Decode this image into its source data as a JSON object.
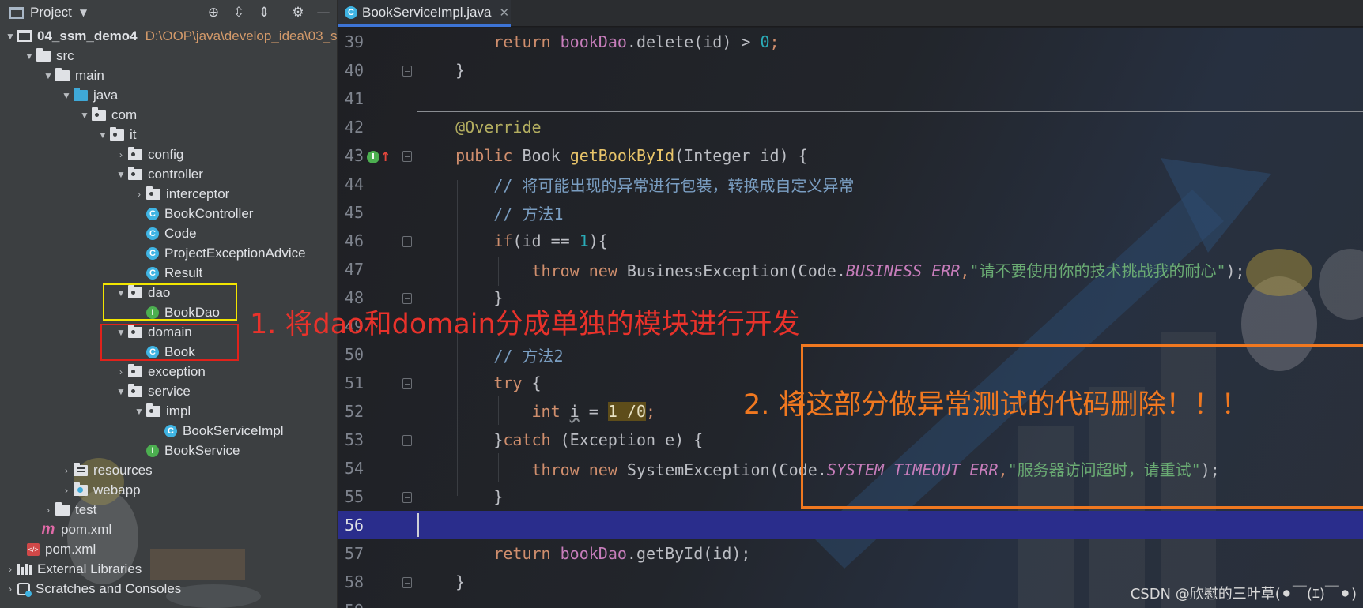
{
  "project_panel": {
    "title": "Project",
    "tools": [
      "target-icon",
      "expand-all-icon",
      "collapse-all-icon",
      "gear-icon",
      "minimize-icon"
    ],
    "tree": [
      {
        "label": "04_ssm_demo4",
        "path": "D:\\OOP\\java\\develop_idea\\03_s",
        "icon": "module-icon"
      },
      {
        "label": "src",
        "icon": "folder-icon"
      },
      {
        "label": "main",
        "icon": "folder-icon"
      },
      {
        "label": "java",
        "icon": "source-folder-icon"
      },
      {
        "label": "com",
        "icon": "package-icon"
      },
      {
        "label": "it",
        "icon": "package-icon"
      },
      {
        "label": "config",
        "icon": "package-icon"
      },
      {
        "label": "controller",
        "icon": "package-icon"
      },
      {
        "label": "interceptor",
        "icon": "package-icon"
      },
      {
        "label": "BookController",
        "icon": "class-icon"
      },
      {
        "label": "Code",
        "icon": "class-icon"
      },
      {
        "label": "ProjectExceptionAdvice",
        "icon": "class-icon"
      },
      {
        "label": "Result",
        "icon": "class-icon"
      },
      {
        "label": "dao",
        "icon": "package-icon"
      },
      {
        "label": "BookDao",
        "icon": "interface-icon"
      },
      {
        "label": "domain",
        "icon": "package-icon"
      },
      {
        "label": "Book",
        "icon": "class-icon"
      },
      {
        "label": "exception",
        "icon": "package-icon"
      },
      {
        "label": "service",
        "icon": "package-icon"
      },
      {
        "label": "impl",
        "icon": "package-icon"
      },
      {
        "label": "BookServiceImpl",
        "icon": "class-icon"
      },
      {
        "label": "BookService",
        "icon": "interface-icon"
      },
      {
        "label": "resources",
        "icon": "resources-folder-icon"
      },
      {
        "label": "webapp",
        "icon": "web-folder-icon"
      },
      {
        "label": "test",
        "icon": "folder-icon"
      },
      {
        "label": "pom.xml",
        "icon": "maven-icon"
      },
      {
        "label": "pom.xml",
        "icon": "xml-icon"
      },
      {
        "label": "External Libraries",
        "icon": "library-icon"
      },
      {
        "label": "Scratches and Consoles",
        "icon": "scratch-icon"
      }
    ]
  },
  "editor": {
    "tab": {
      "label": "BookServiceImpl.java",
      "close": "✕"
    },
    "line_numbers": [
      "39",
      "40",
      "41",
      "42",
      "43",
      "44",
      "45",
      "46",
      "47",
      "48",
      "49",
      "50",
      "51",
      "52",
      "53",
      "54",
      "55",
      "56",
      "57",
      "58",
      "59"
    ],
    "current_line": "56",
    "code": {
      "l39_a": "return ",
      "l39_b": "bookDao",
      "l39_c": ".delete(id) > ",
      "l39_d": "0",
      "l39_e": ";",
      "l40": "}",
      "l42": "@Override",
      "l43_a": "public ",
      "l43_b": "Book ",
      "l43_c": "getBookById",
      "l43_d": "(Integer id) {",
      "l44": "// 将可能出现的异常进行包装，转换成自定义异常",
      "l45": "// 方法1",
      "l46_a": "if",
      "l46_b": "(id == ",
      "l46_c": "1",
      "l46_d": "){",
      "l47_a": "throw new ",
      "l47_b": "BusinessException(Code.",
      "l47_c": "BUSINESS_ERR",
      "l47_d": ",",
      "l47_e": "\"请不要使用你的技术挑战我的耐心\"",
      "l47_f": ");",
      "l48": "}",
      "l50": "// 方法2",
      "l51_a": "try",
      "l51_b": " {",
      "l52_a": "int ",
      "l52_b": "i",
      "l52_c": " = ",
      "l52_d": "1 /0",
      "l52_e": ";",
      "l53_a": "}",
      "l53_b": "catch",
      "l53_c": " (Exception e) {",
      "l54_a": "throw new ",
      "l54_b": "SystemException(Code.",
      "l54_c": "SYSTEM_TIMEOUT_ERR",
      "l54_d": ",",
      "l54_e": "\"服务器访问超时，请重试\"",
      "l54_f": ");",
      "l55": "}",
      "l57_a": "return ",
      "l57_b": "bookDao",
      "l57_c": ".getById(id);",
      "l58": "}"
    }
  },
  "annotations": {
    "note1": "1. 将dao和domain分成单独的模块进行开发",
    "note2": "2. 将这部分做异常测试的代码删除！！！",
    "colors": {
      "yellow_box": "#f2e600",
      "red_box": "#e0221b",
      "orange_box": "#f07820"
    }
  },
  "watermark": "CSDN @欣慰的三叶草(⚫￣(ｴ)￣⚫)"
}
